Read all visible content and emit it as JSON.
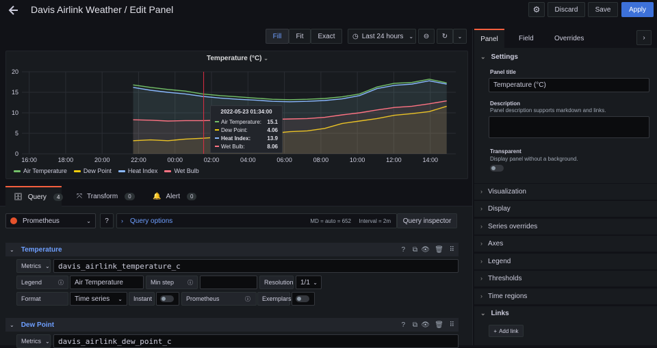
{
  "header": {
    "title": "Davis Airlink Weather / Edit Panel",
    "discard": "Discard",
    "save": "Save",
    "apply": "Apply"
  },
  "toolbar": {
    "fill": "Fill",
    "fit": "Fit",
    "exact": "Exact",
    "time_range": "Last 24 hours"
  },
  "panel": {
    "title": "Temperature (°C)"
  },
  "chart_data": {
    "type": "line",
    "x_ticks": [
      "16:00",
      "18:00",
      "20:00",
      "22:00",
      "00:00",
      "02:00",
      "04:00",
      "06:00",
      "08:00",
      "10:00",
      "12:00",
      "14:00"
    ],
    "y_ticks": [
      "0",
      "5",
      "10",
      "15",
      "20"
    ],
    "ylim": [
      0,
      20
    ],
    "legend": "bottom",
    "series": [
      {
        "name": "Air Temperature",
        "color": "#73bf69",
        "values": [
          16.8,
          16.2,
          15.7,
          15.3,
          14.6,
          14.2,
          13.9,
          13.6,
          13.3,
          13.2,
          13.3,
          13.5,
          13.9,
          14.6,
          16.3,
          17.2,
          17.4,
          18.2,
          17.3
        ]
      },
      {
        "name": "Dew Point",
        "color": "#f2cc0c",
        "values": [
          3.2,
          3.4,
          3.2,
          3.6,
          3.8,
          4.1,
          4.6,
          4.2,
          5.0,
          5.4,
          5.6,
          6.2,
          7.4,
          8.0,
          8.6,
          9.4,
          9.8,
          10.3,
          11.6
        ]
      },
      {
        "name": "Heat Index",
        "color": "#8ab8ff",
        "values": [
          16.2,
          15.5,
          15.0,
          14.6,
          14.0,
          13.6,
          13.3,
          13.1,
          12.8,
          12.7,
          12.8,
          13.0,
          13.4,
          14.2,
          15.9,
          16.7,
          17.0,
          17.8,
          17.0
        ]
      },
      {
        "name": "Wet Bulb",
        "color": "#ff7383",
        "values": [
          8.3,
          8.2,
          8.0,
          8.1,
          8.1,
          8.2,
          8.3,
          8.2,
          8.4,
          8.5,
          8.6,
          8.9,
          9.5,
          10.0,
          10.7,
          11.3,
          11.6,
          12.2,
          12.9
        ]
      }
    ],
    "start_hour": 21.7,
    "end_hour": 38.9
  },
  "tooltip": {
    "time": "2022-05-23 01:34:00",
    "rows": [
      {
        "label": "Air Temperature:",
        "value": "15.1"
      },
      {
        "label": "Dew Point:",
        "value": "4.06"
      },
      {
        "label": "Heat Index:",
        "value": "13.9"
      },
      {
        "label": "Wet Bulb:",
        "value": "8.06"
      }
    ]
  },
  "tabs": {
    "query": "Query",
    "query_count": "4",
    "transform": "Transform",
    "transform_count": "0",
    "alert": "Alert",
    "alert_count": "0"
  },
  "datasource": {
    "name": "Prometheus",
    "query_options": "Query options",
    "md": "MD = auto = 652",
    "interval": "Interval = 2m",
    "inspector": "Query inspector"
  },
  "queries": [
    {
      "title": "Temperature",
      "metrics_label": "Metrics",
      "metric": "davis_airlink_temperature_c",
      "legend_label": "Legend",
      "legend_value": "Air Temperature",
      "min_step": "Min step",
      "resolution": "Resolution",
      "resolution_value": "1/1",
      "format_label": "Format",
      "format_value": "Time series",
      "instant": "Instant",
      "prometheus": "Prometheus",
      "exemplars": "Exemplars"
    },
    {
      "title": "Dew Point",
      "metrics_label": "Metrics",
      "metric": "davis_airlink_dew_point_c"
    }
  ],
  "sidebar": {
    "tabs": [
      "Panel",
      "Field",
      "Overrides"
    ],
    "settings": "Settings",
    "panel_title_label": "Panel title",
    "panel_title_value": "Temperature (°C)",
    "description_label": "Description",
    "description_help": "Panel description supports markdown and links.",
    "transparent_label": "Transparent",
    "transparent_help": "Display panel without a background.",
    "sections": [
      "Visualization",
      "Display",
      "Series overrides",
      "Axes",
      "Legend",
      "Thresholds",
      "Time regions"
    ],
    "links": "Links",
    "add_link": "Add link"
  }
}
